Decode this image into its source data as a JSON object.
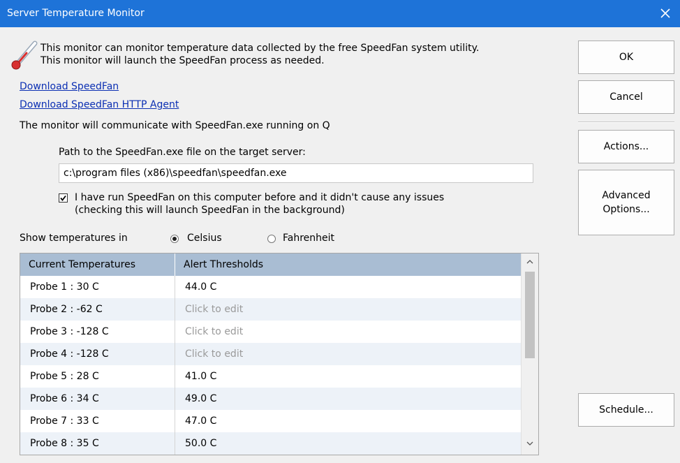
{
  "window": {
    "title": "Server Temperature Monitor"
  },
  "intro": {
    "line1": "This monitor can monitor temperature data collected by the free SpeedFan system utility.",
    "line2": "This monitor will launch the SpeedFan process as needed."
  },
  "links": {
    "download_speedfan": "Download SpeedFan",
    "download_agent": "Download SpeedFan HTTP Agent"
  },
  "communicate_text": "The monitor will communicate with SpeedFan.exe running on Q",
  "path": {
    "label": "Path to the SpeedFan.exe file on the target server:",
    "value": "c:\\program files (x86)\\speedfan\\speedfan.exe"
  },
  "checkbox": {
    "checked": true,
    "line1": "I have run SpeedFan on this computer before and it didn't cause any issues",
    "line2": "(checking this will launch SpeedFan in the background)"
  },
  "units": {
    "label": "Show temperatures in",
    "options": [
      "Celsius",
      "Fahrenheit"
    ],
    "selected": "Celsius"
  },
  "grid": {
    "columns": [
      "Current Temperatures",
      "Alert Thresholds"
    ],
    "rows": [
      {
        "probe": "Probe 1 : 30 C",
        "threshold": "44.0 C",
        "is_placeholder": false
      },
      {
        "probe": "Probe 2 : -62 C",
        "threshold": "Click to edit",
        "is_placeholder": true
      },
      {
        "probe": "Probe 3 : -128 C",
        "threshold": "Click to edit",
        "is_placeholder": true
      },
      {
        "probe": "Probe 4 : -128 C",
        "threshold": "Click to edit",
        "is_placeholder": true
      },
      {
        "probe": "Probe 5 : 28 C",
        "threshold": "41.0 C",
        "is_placeholder": false
      },
      {
        "probe": "Probe 6 : 34 C",
        "threshold": "49.0 C",
        "is_placeholder": false
      },
      {
        "probe": "Probe 7 : 33 C",
        "threshold": "47.0 C",
        "is_placeholder": false
      },
      {
        "probe": "Probe 8 : 35 C",
        "threshold": "50.0 C",
        "is_placeholder": false
      }
    ]
  },
  "buttons": {
    "ok": "OK",
    "cancel": "Cancel",
    "actions": "Actions...",
    "advanced_line1": "Advanced",
    "advanced_line2": "Options...",
    "schedule": "Schedule..."
  },
  "colors": {
    "titlebar": "#1e73d8",
    "grid_header": "#a9bdd3",
    "link": "#0b2fb3",
    "placeholder": "#9a9a9a"
  },
  "icons": [
    "thermometer-icon",
    "close-icon",
    "checkmark-icon",
    "scroll-up-icon",
    "scroll-down-icon"
  ]
}
